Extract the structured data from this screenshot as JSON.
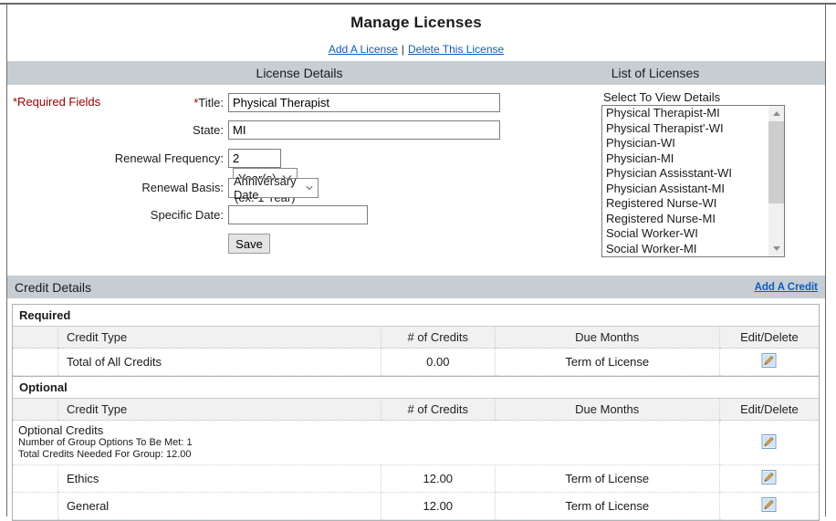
{
  "colors": {
    "header_bar": "#c6ced3",
    "link_blue": "#0a5dc2",
    "required_note_red": "#990000"
  },
  "page": {
    "title": "Manage Licenses",
    "top_links": {
      "add_license": "Add A License",
      "separator": "|",
      "delete_license": "Delete This License"
    }
  },
  "license_details": {
    "header": "License Details",
    "required_fields_note": "*Required Fields",
    "fields": {
      "title": {
        "required_mark": "*",
        "label": "Title:",
        "value": "Physical Therapist"
      },
      "state": {
        "label": "State:",
        "value": "MI"
      },
      "renewal_frequency": {
        "label": "Renewal Frequency:",
        "value": "2",
        "unit_selected": "Year(s)",
        "hint": "(ex. 1 Year)"
      },
      "renewal_basis": {
        "label": "Renewal Basis:",
        "selected": "Anniversary Date"
      },
      "specific_date": {
        "label": "Specific Date:",
        "value": "",
        "placeholder": ""
      }
    },
    "save_label": "Save"
  },
  "list_of_licenses": {
    "header": "List of Licenses",
    "select_label": "Select To View Details",
    "items": [
      "Physical Therapist-MI",
      "Physical Therapist'-WI",
      "Physician-WI",
      "Physician-MI",
      "Physician Assisstant-WI",
      "Physician Assistant-MI",
      "Registered Nurse-WI",
      "Registered Nurse-MI",
      "Social Worker-WI",
      "Social Worker-MI"
    ]
  },
  "credit": {
    "header": "Credit Details",
    "add_credit_link": "Add A Credit",
    "columns": [
      "Credit Type",
      "# of Credits",
      "Due Months",
      "Edit/Delete"
    ],
    "edit_icon": "edit-icon",
    "required": {
      "title": "Required",
      "rows": [
        {
          "credit_type": "Total of All Credits",
          "credits": "0.00",
          "due_months": "Term of License"
        }
      ]
    },
    "optional": {
      "title": "Optional",
      "group": {
        "line1": "Optional Credits",
        "line2": "Number of Group Options To Be Met: 1",
        "line3": "Total Credits Needed For Group: 12.00"
      },
      "rows": [
        {
          "credit_type": "Ethics",
          "credits": "12.00",
          "due_months": "Term of License"
        },
        {
          "credit_type": "General",
          "credits": "12.00",
          "due_months": "Term of License"
        }
      ]
    }
  }
}
